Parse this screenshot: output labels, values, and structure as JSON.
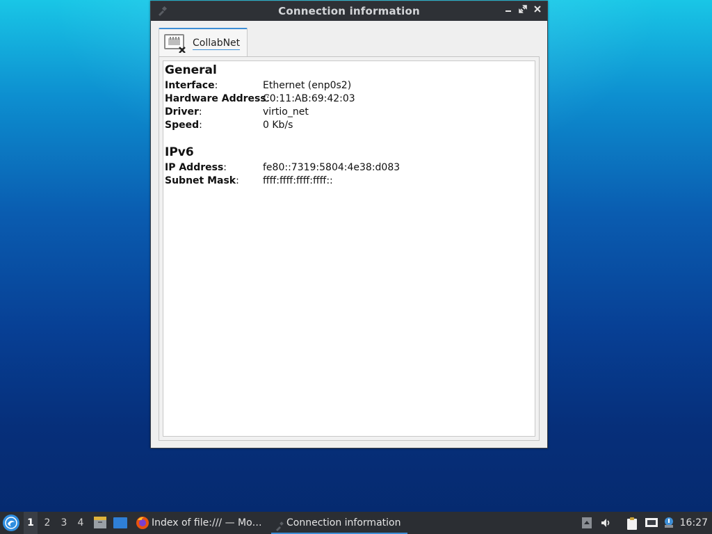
{
  "window": {
    "title": "Connection information"
  },
  "tabs": [
    {
      "label": "CollabNet"
    }
  ],
  "general": {
    "heading": "General",
    "rows": [
      {
        "key": "Interface",
        "value": "Ethernet (enp0s2)"
      },
      {
        "key": "Hardware Address",
        "value": "C0:11:AB:69:42:03"
      },
      {
        "key": "Driver",
        "value": "virtio_net"
      },
      {
        "key": "Speed",
        "value": "0 Kb/s"
      }
    ]
  },
  "ipv6": {
    "heading": "IPv6",
    "rows": [
      {
        "key": "IP Address",
        "value": "fe80::7319:5804:4e38:d083"
      },
      {
        "key": "Subnet Mask",
        "value": "ffff:ffff:ffff:ffff::"
      }
    ]
  },
  "taskbar": {
    "workspaces": [
      "1",
      "2",
      "3",
      "4"
    ],
    "tasks": [
      {
        "label": "Index of file:/// — Mo…"
      },
      {
        "label": "Connection information"
      }
    ],
    "clock": "16:27"
  },
  "colors": {
    "accent": "#3d8ed6",
    "titlebar": "#2e3136",
    "taskbar": "#2b2e33"
  }
}
